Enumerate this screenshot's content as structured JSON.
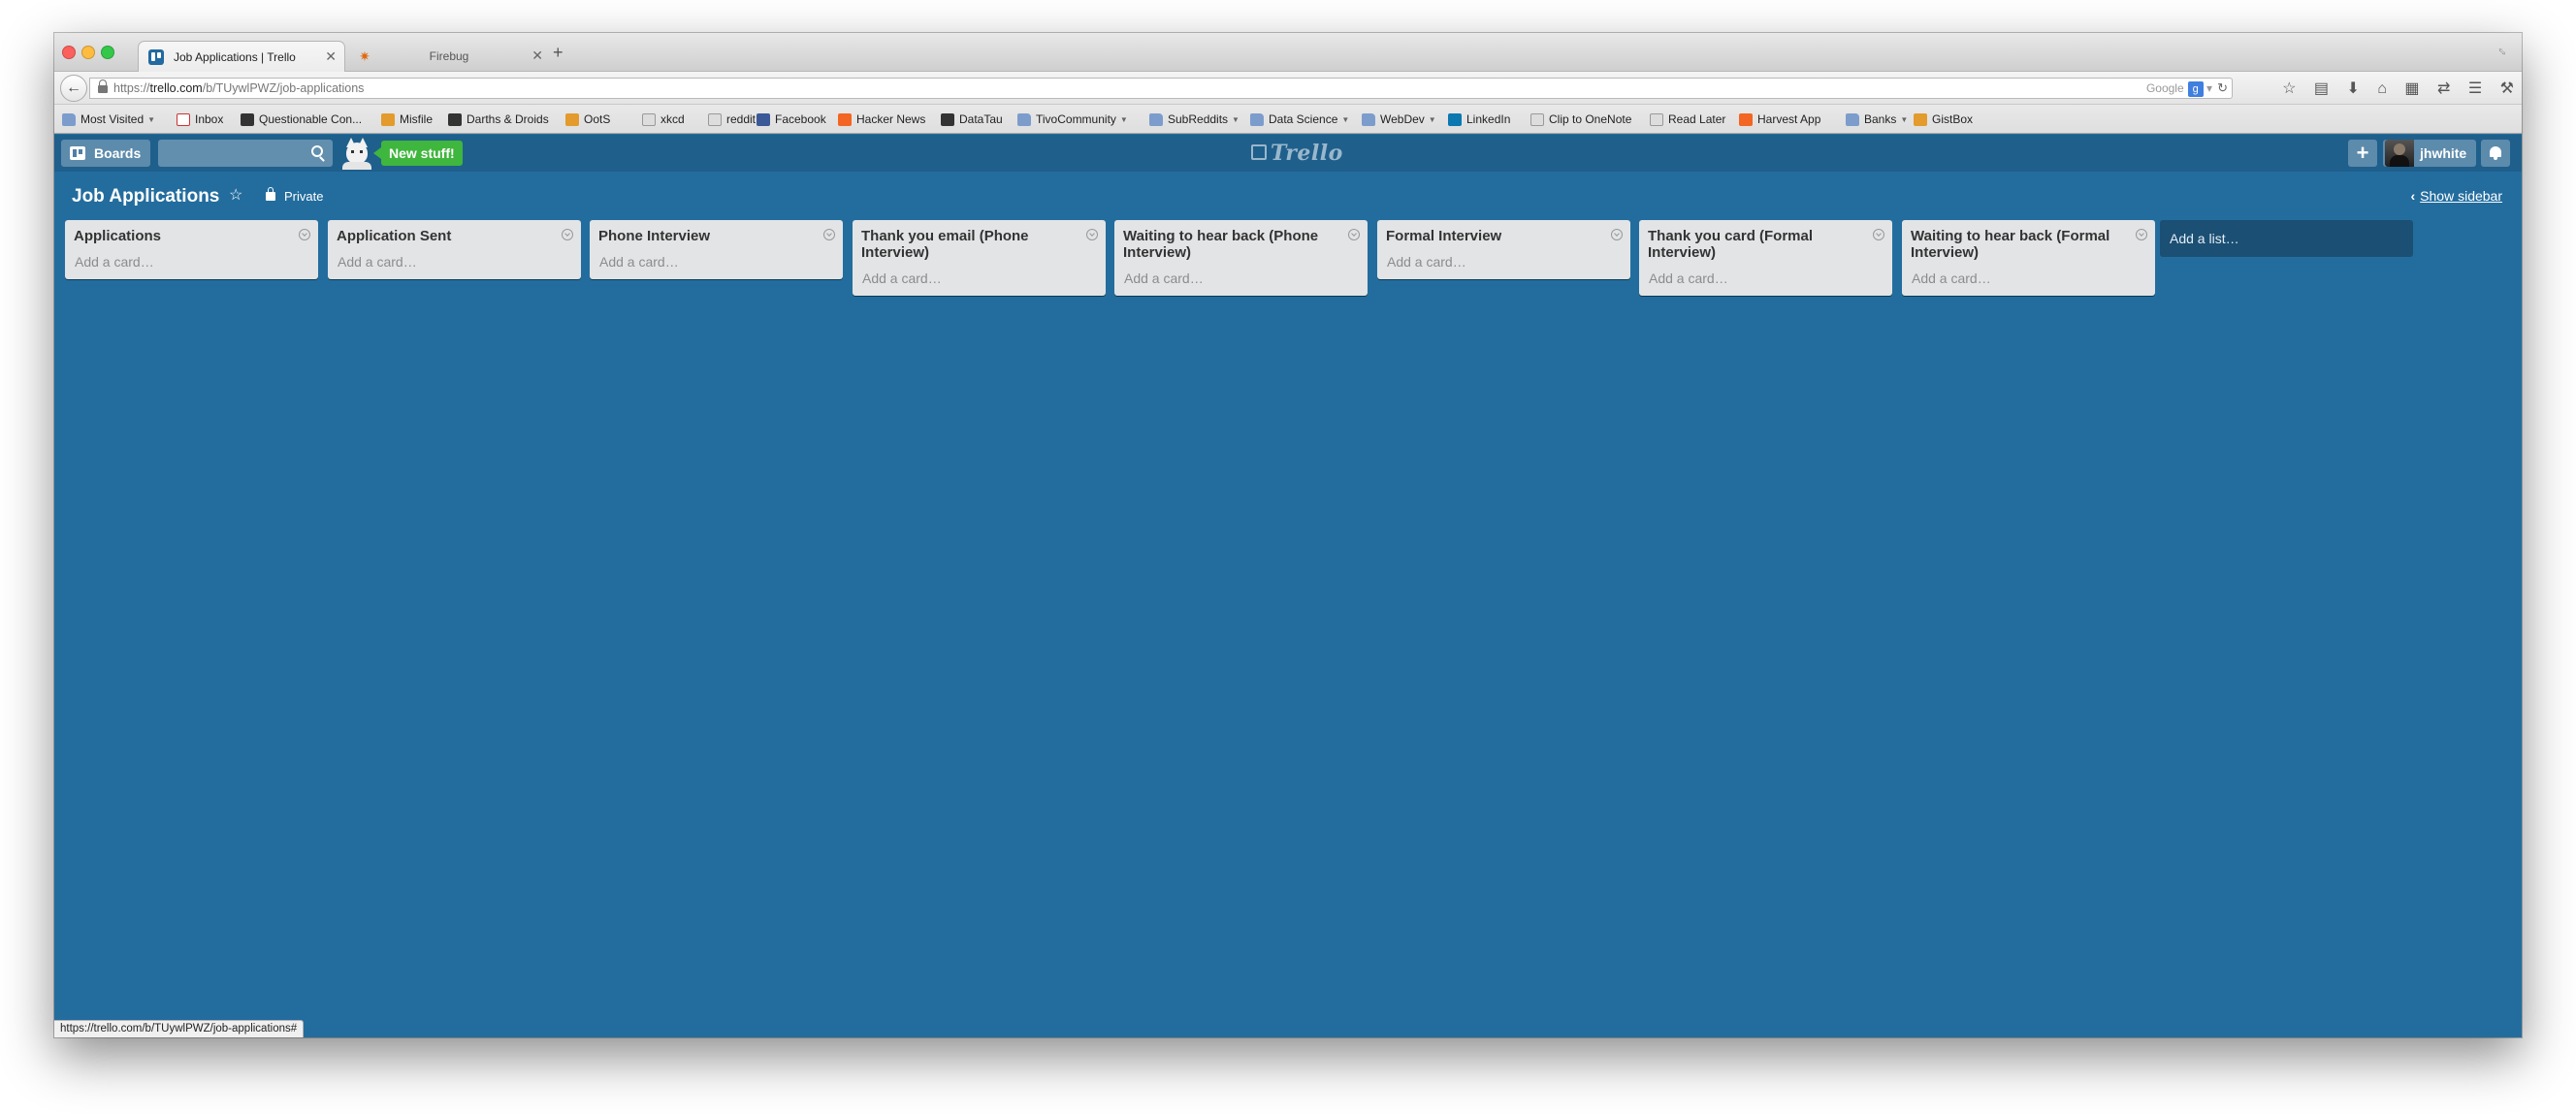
{
  "browser": {
    "tabs": [
      {
        "title": "Job Applications | Trello",
        "active": true
      },
      {
        "title": "Firebug",
        "active": false
      }
    ],
    "url": {
      "prefix": "https://",
      "domain": "trello.com",
      "path": "/b/TUywlPWZ/job-applications"
    },
    "search_engine": "Google",
    "status_url": "https://trello.com/b/TUywlPWZ/job-applications#",
    "bookmarks": [
      {
        "label": "Most Visited",
        "icon": "folder",
        "dropdown": true
      },
      {
        "label": "Inbox",
        "icon": "gmail"
      },
      {
        "label": "Questionable Con...",
        "icon": "dark"
      },
      {
        "label": "Misfile",
        "icon": "amber"
      },
      {
        "label": "Darths & Droids",
        "icon": "dark"
      },
      {
        "label": "OotS",
        "icon": "amber"
      },
      {
        "label": "xkcd",
        "icon": "gray"
      },
      {
        "label": "reddit",
        "icon": "gray"
      },
      {
        "label": "Facebook",
        "icon": "blue"
      },
      {
        "label": "Hacker News",
        "icon": "orange"
      },
      {
        "label": "DataTau",
        "icon": "dark"
      },
      {
        "label": "TivoCommunity",
        "icon": "folder",
        "dropdown": true
      },
      {
        "label": "SubReddits",
        "icon": "folder",
        "dropdown": true
      },
      {
        "label": "Data Science",
        "icon": "folder",
        "dropdown": true
      },
      {
        "label": "WebDev",
        "icon": "folder",
        "dropdown": true
      },
      {
        "label": "LinkedIn",
        "icon": "teal"
      },
      {
        "label": "Clip to OneNote",
        "icon": "gray"
      },
      {
        "label": "Read Later",
        "icon": "gray"
      },
      {
        "label": "Harvest App",
        "icon": "orange"
      },
      {
        "label": "Banks",
        "icon": "folder",
        "dropdown": true
      },
      {
        "label": "GistBox",
        "icon": "amber"
      }
    ]
  },
  "header": {
    "boards_label": "Boards",
    "search_placeholder": "",
    "new_stuff_label": "New stuff!",
    "logo_text": "Trello",
    "add_label": "+",
    "username": "jhwhite"
  },
  "board": {
    "title": "Job Applications",
    "visibility": "Private",
    "show_sidebar_label": "Show sidebar",
    "lists": [
      {
        "title": "Applications",
        "add_card": "Add a card…"
      },
      {
        "title": "Application Sent",
        "add_card": "Add a card…"
      },
      {
        "title": "Phone Interview",
        "add_card": "Add a card…"
      },
      {
        "title": "Thank you email (Phone Interview)",
        "add_card": "Add a card…"
      },
      {
        "title": "Waiting to hear back (Phone Interview)",
        "add_card": "Add a card…"
      },
      {
        "title": "Formal Interview",
        "add_card": "Add a card…"
      },
      {
        "title": "Thank you card (Formal Interview)",
        "add_card": "Add a card…"
      },
      {
        "title": "Waiting to hear back (Formal Interview)",
        "add_card": "Add a card…"
      }
    ],
    "add_list_label": "Add a list…"
  },
  "colors": {
    "board_background": "#236d9e",
    "header": "#1f5f8c",
    "new_stuff": "#3fb63d",
    "list_background": "#e2e4e6"
  }
}
